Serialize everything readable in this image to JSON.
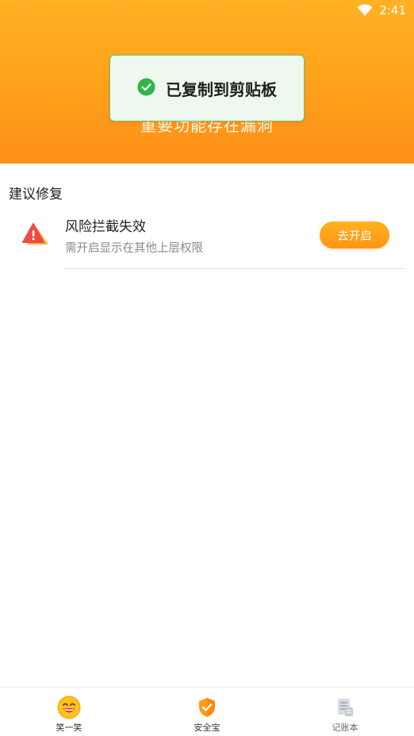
{
  "status_bar": {
    "time": "2:41"
  },
  "header": {
    "subtitle": "重要功能存在漏洞"
  },
  "toast": {
    "text": "已复制到剪贴板"
  },
  "section": {
    "title": "建议修复"
  },
  "risk_item": {
    "title": "风险拦截失效",
    "description": "需开启显示在其他上层权限",
    "button_label": "去开启"
  },
  "bottom_nav": {
    "items": [
      {
        "label": "笑一笑",
        "icon": "smile-face-icon"
      },
      {
        "label": "安全宝",
        "icon": "shield-check-icon"
      },
      {
        "label": "记账本",
        "icon": "ledger-icon"
      }
    ]
  },
  "colors": {
    "accent": "#ffa01a",
    "toast_border": "#6dc56f",
    "risk_red": "#ee4a4a"
  }
}
